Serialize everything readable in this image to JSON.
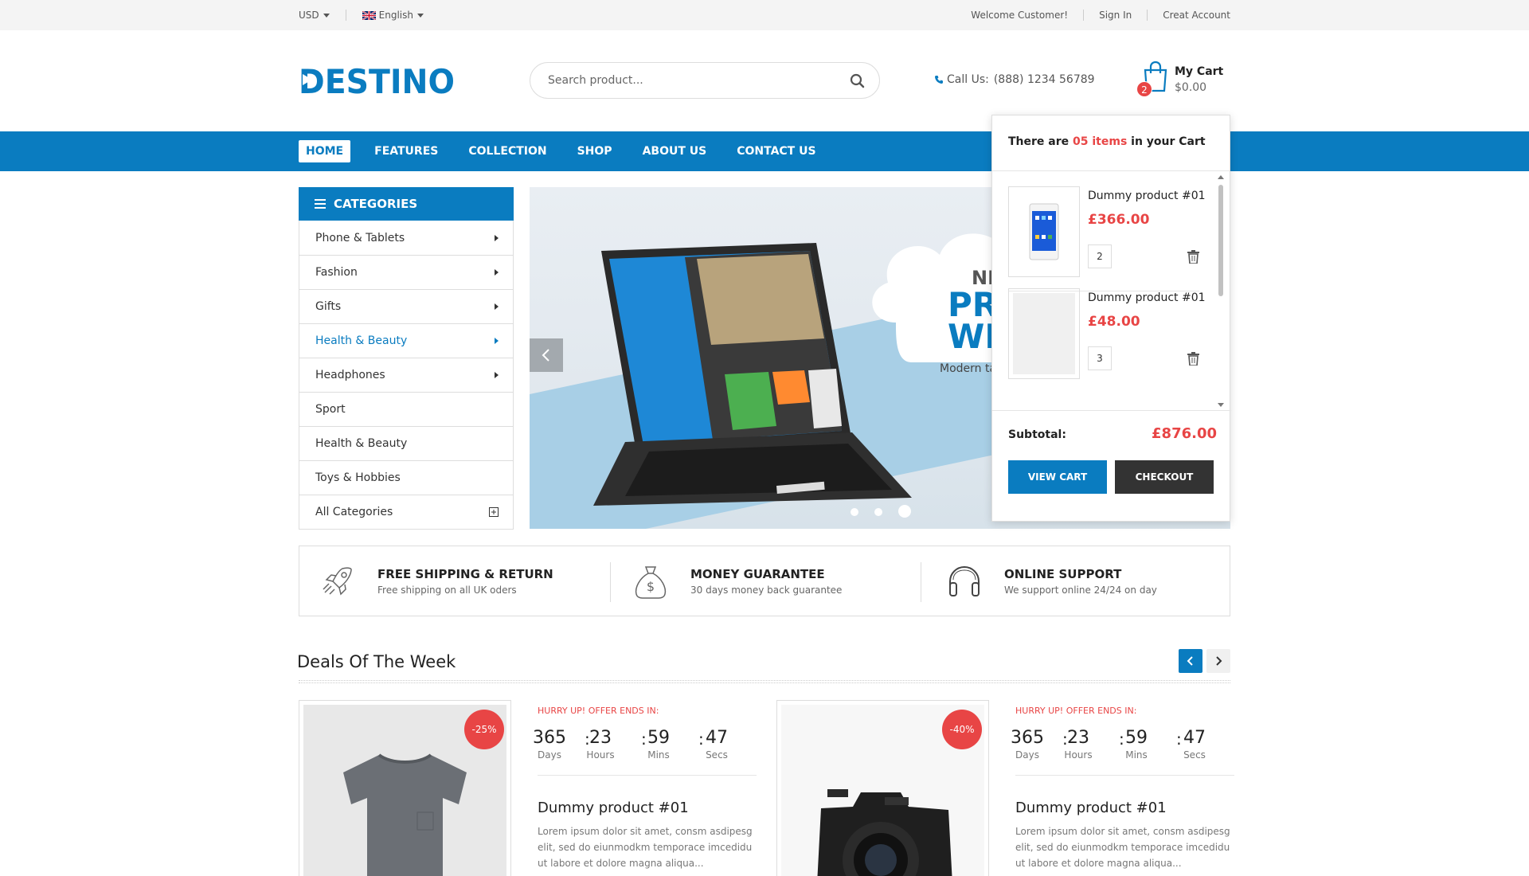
{
  "topbar": {
    "currency": "USD",
    "language": "English",
    "welcome": "Welcome Customer!",
    "sign_in": "Sign In",
    "create_account": "Creat Account"
  },
  "header": {
    "logo_text": "DESTINO",
    "search_placeholder": "Search product...",
    "call_label": "Call Us:",
    "phone": "(888) 1234 56789",
    "cart_label": "My Cart",
    "cart_amount": "$0.00",
    "cart_count": "2"
  },
  "nav": {
    "items": [
      "HOME",
      "FEATURES",
      "COLLECTION",
      "SHOP",
      "ABOUT US",
      "CONTACT US"
    ]
  },
  "categories": {
    "title": "CATEGORIES",
    "items": [
      "Phone & Tablets",
      "Fashion",
      "Gifts",
      "Health & Beauty",
      "Headphones",
      "Sport",
      "Health & Beauty",
      "Toys & Hobbies",
      "All Categories"
    ]
  },
  "slider": {
    "line1": "NEW",
    "line2a": "PRO",
    "line2b": "WI",
    "line3": "Modern table"
  },
  "cart_dropdown": {
    "prefix": "There are",
    "count": "05 items",
    "suffix": "in your Cart",
    "items": [
      {
        "name": "Dummy product #01",
        "price": "£366.00",
        "qty": "2"
      },
      {
        "name": "Dummy product #01",
        "price": "£48.00",
        "qty": "3"
      }
    ],
    "subtotal_label": "Subtotal:",
    "subtotal_value": "£876.00",
    "view_cart": "VIEW CART",
    "checkout": "CHECKOUT"
  },
  "features": [
    {
      "title": "FREE SHIPPING & RETURN",
      "desc": "Free shipping on all UK oders",
      "icon": "rocket-icon"
    },
    {
      "title": "MONEY GUARANTEE",
      "desc": "30 days money back guarantee",
      "icon": "money-bag-icon"
    },
    {
      "title": "ONLINE SUPPORT",
      "desc": "We support online 24/24 on day",
      "icon": "headphones-icon"
    }
  ],
  "deals": {
    "title": "Deals Of The Week",
    "products": [
      {
        "discount": "-25%",
        "hurry": "HURRY UP! OFFER ENDS IN:",
        "days": "365",
        "hours": "23",
        "mins": "59",
        "secs": "47",
        "days_label": "Days",
        "hours_label": "Hours",
        "mins_label": "Mins",
        "secs_label": "Secs",
        "name": "Dummy product #01",
        "desc": "Lorem ipsum dolor sit amet, consm asdipesg elit, sed do eiunmodkm temporace imcedidu ut labore et dolore magna aliqua..."
      },
      {
        "discount": "-40%",
        "hurry": "HURRY UP! OFFER ENDS IN:",
        "days": "365",
        "hours": "23",
        "mins": "59",
        "secs": "47",
        "days_label": "Days",
        "hours_label": "Hours",
        "mins_label": "Mins",
        "secs_label": "Secs",
        "name": "Dummy product #01",
        "desc": "Lorem ipsum dolor sit amet, consm asdipesg elit, sed do eiunmodkm temporace imcedidu ut labore et dolore magna aliqua..."
      }
    ]
  },
  "colors": {
    "brand_blue": "#0a7cc0",
    "accent_red": "#e84545",
    "dark": "#333333"
  }
}
